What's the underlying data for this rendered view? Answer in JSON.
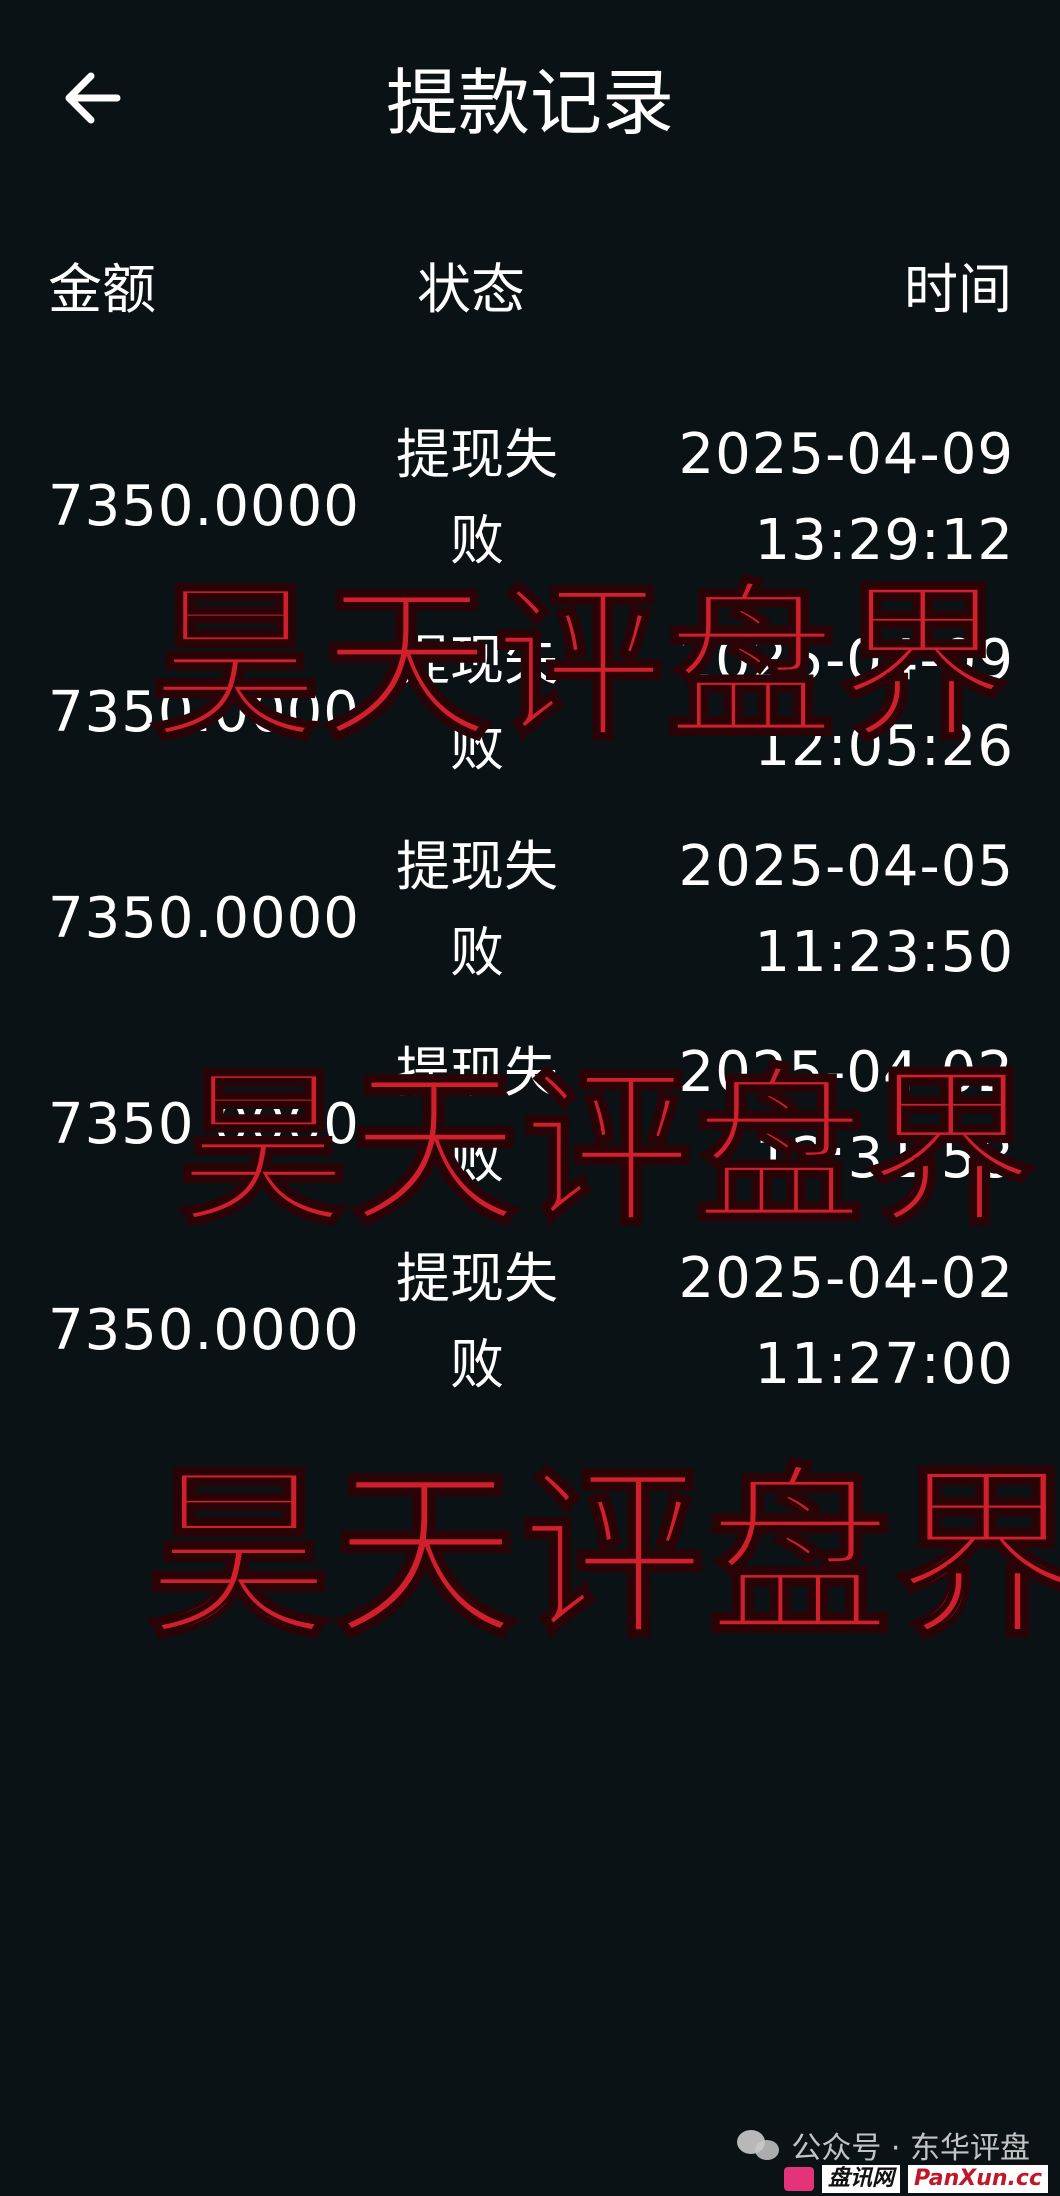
{
  "header": {
    "title": "提款记录",
    "back_icon": "arrow-left-icon"
  },
  "columns": {
    "amount": "金额",
    "status": "状态",
    "time": "时间"
  },
  "records": [
    {
      "amount": "7350.0000",
      "status": "提现失败",
      "date": "2025-04-09",
      "time": "13:29:12"
    },
    {
      "amount": "7350.0000",
      "status": "提现失败",
      "date": "2025-04-09",
      "time": "12:05:26"
    },
    {
      "amount": "7350.0000",
      "status": "提现失败",
      "date": "2025-04-05",
      "time": "11:23:50"
    },
    {
      "amount": "7350.0000",
      "status": "提现失败",
      "date": "2025-04-02",
      "time": "12:31:58"
    },
    {
      "amount": "7350.0000",
      "status": "提现失败",
      "date": "2025-04-02",
      "time": "11:27:00"
    }
  ],
  "watermarks": [
    "昊天评盘界",
    "昊天评盘界",
    "昊天评盘界"
  ],
  "footer": {
    "account": "公众号 · 东华评盘",
    "site_cn": "盘讯网",
    "site_en": "PanXun.cc"
  },
  "colors": {
    "background": "#0b1216",
    "text": "#ffffff",
    "watermark": "#d21f2c"
  }
}
